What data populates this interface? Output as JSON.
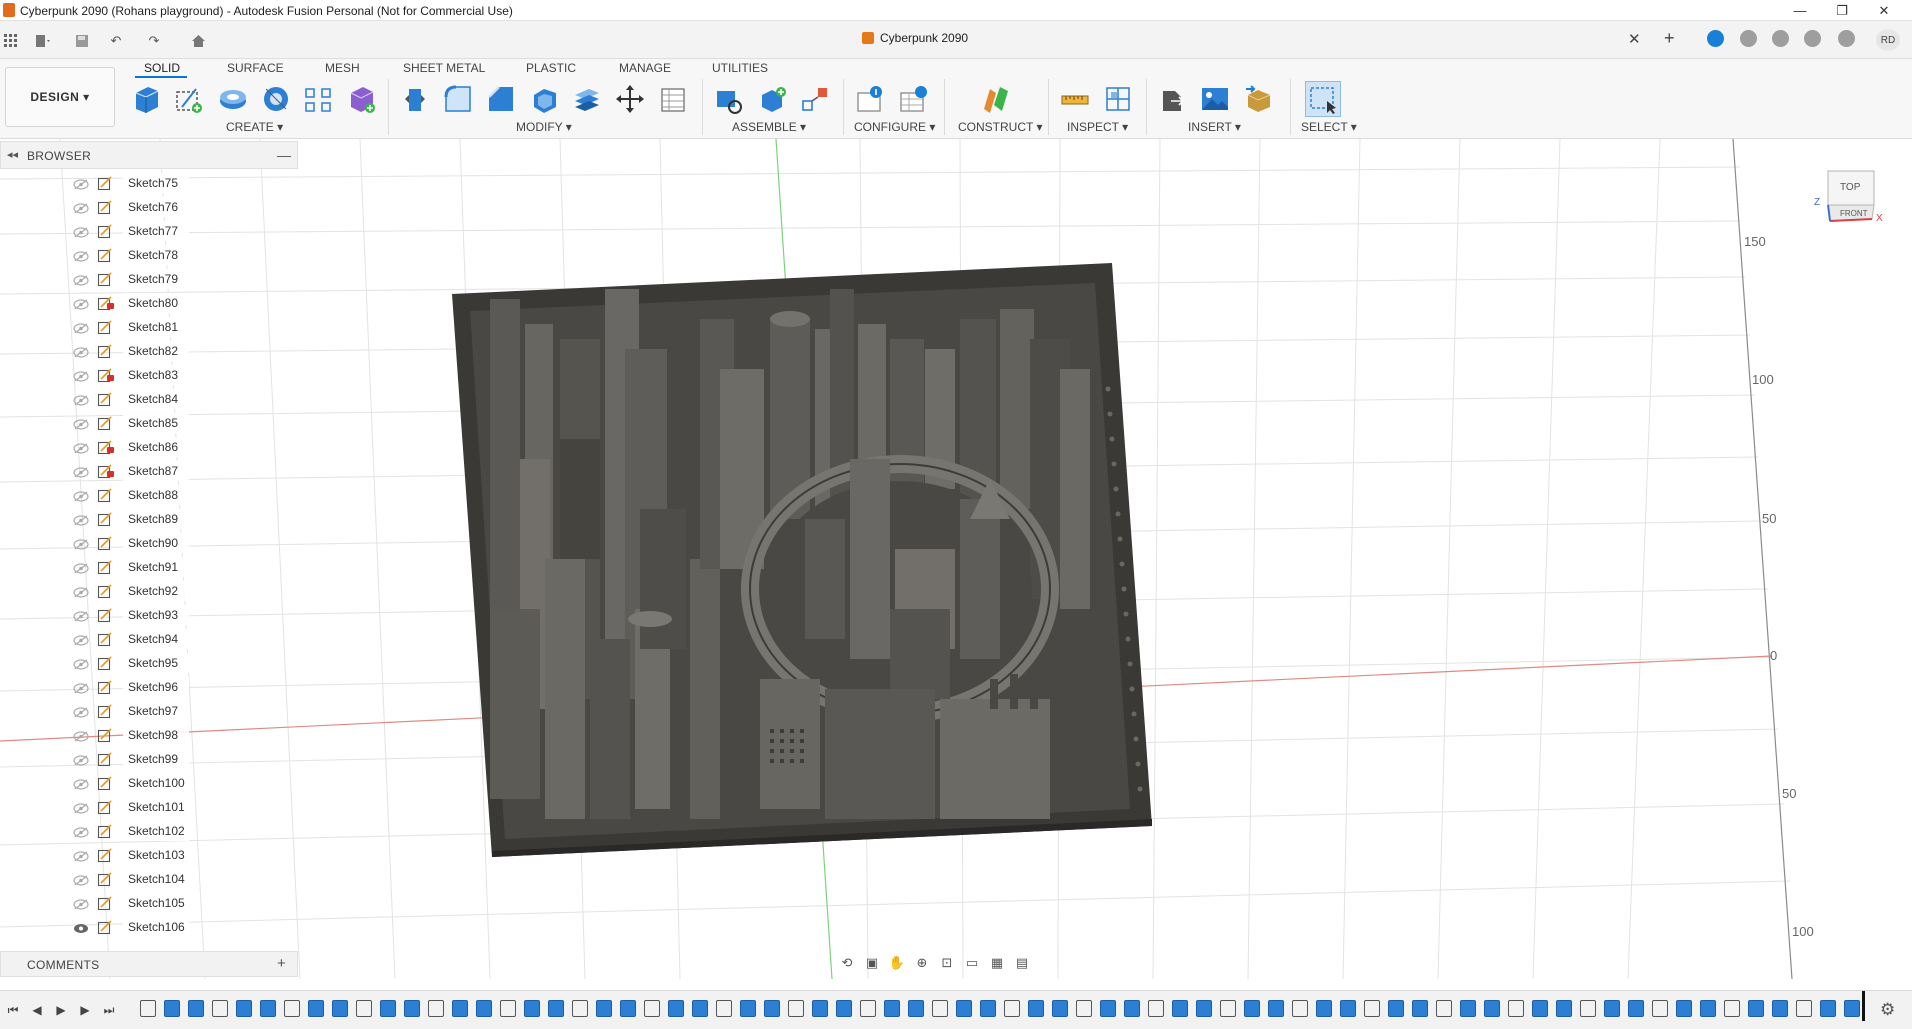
{
  "window": {
    "title": "Cyberpunk 2090 (Rohans playground) - Autodesk Fusion Personal (Not for Commercial Use)",
    "controls": [
      "minimize",
      "maximize",
      "close"
    ]
  },
  "tabbar": {
    "document_name": "Cyberpunk 2090",
    "user_initials": "RD"
  },
  "ribbon": {
    "workspace": "DESIGN ▾",
    "tabs": [
      "SOLID",
      "SURFACE",
      "MESH",
      "SHEET METAL",
      "PLASTIC",
      "MANAGE",
      "UTILITIES"
    ],
    "active_tab": "SOLID",
    "groups": {
      "create": "CREATE ▾",
      "modify": "MODIFY ▾",
      "assemble": "ASSEMBLE ▾",
      "configure": "CONFIGURE ▾",
      "construct": "CONSTRUCT ▾",
      "inspect": "INSPECT ▾",
      "insert": "INSERT ▾",
      "select": "SELECT ▾"
    }
  },
  "browser": {
    "title": "BROWSER",
    "sketches": [
      {
        "label": "Sketch75",
        "locked": false,
        "visible": false
      },
      {
        "label": "Sketch76",
        "locked": false,
        "visible": false
      },
      {
        "label": "Sketch77",
        "locked": false,
        "visible": false
      },
      {
        "label": "Sketch78",
        "locked": false,
        "visible": false
      },
      {
        "label": "Sketch79",
        "locked": false,
        "visible": false
      },
      {
        "label": "Sketch80",
        "locked": true,
        "visible": false
      },
      {
        "label": "Sketch81",
        "locked": false,
        "visible": false
      },
      {
        "label": "Sketch82",
        "locked": false,
        "visible": false
      },
      {
        "label": "Sketch83",
        "locked": true,
        "visible": false
      },
      {
        "label": "Sketch84",
        "locked": false,
        "visible": false
      },
      {
        "label": "Sketch85",
        "locked": false,
        "visible": false
      },
      {
        "label": "Sketch86",
        "locked": true,
        "visible": false
      },
      {
        "label": "Sketch87",
        "locked": true,
        "visible": false
      },
      {
        "label": "Sketch88",
        "locked": false,
        "visible": false
      },
      {
        "label": "Sketch89",
        "locked": false,
        "visible": false
      },
      {
        "label": "Sketch90",
        "locked": false,
        "visible": false
      },
      {
        "label": "Sketch91",
        "locked": false,
        "visible": false
      },
      {
        "label": "Sketch92",
        "locked": false,
        "visible": false
      },
      {
        "label": "Sketch93",
        "locked": false,
        "visible": false
      },
      {
        "label": "Sketch94",
        "locked": false,
        "visible": false
      },
      {
        "label": "Sketch95",
        "locked": false,
        "visible": false
      },
      {
        "label": "Sketch96",
        "locked": false,
        "visible": false
      },
      {
        "label": "Sketch97",
        "locked": false,
        "visible": false
      },
      {
        "label": "Sketch98",
        "locked": false,
        "visible": false
      },
      {
        "label": "Sketch99",
        "locked": false,
        "visible": false
      },
      {
        "label": "Sketch100",
        "locked": false,
        "visible": false
      },
      {
        "label": "Sketch101",
        "locked": false,
        "visible": false
      },
      {
        "label": "Sketch102",
        "locked": false,
        "visible": false
      },
      {
        "label": "Sketch103",
        "locked": false,
        "visible": false
      },
      {
        "label": "Sketch104",
        "locked": false,
        "visible": false
      },
      {
        "label": "Sketch105",
        "locked": false,
        "visible": false
      },
      {
        "label": "Sketch106",
        "locked": false,
        "visible": true
      }
    ]
  },
  "comments": {
    "title": "COMMENTS"
  },
  "viewport": {
    "ruler_labels": [
      "150",
      "100",
      "50",
      "0",
      "50",
      "100"
    ],
    "viewcube": {
      "top": "TOP",
      "front": "FRONT",
      "x": "X",
      "z": "Z"
    }
  },
  "colors": {
    "accent": "#0a74da",
    "x_axis": "#e08a84",
    "y_axis": "#7fd17f",
    "model": "#4a4844",
    "lock": "#d6302c"
  }
}
